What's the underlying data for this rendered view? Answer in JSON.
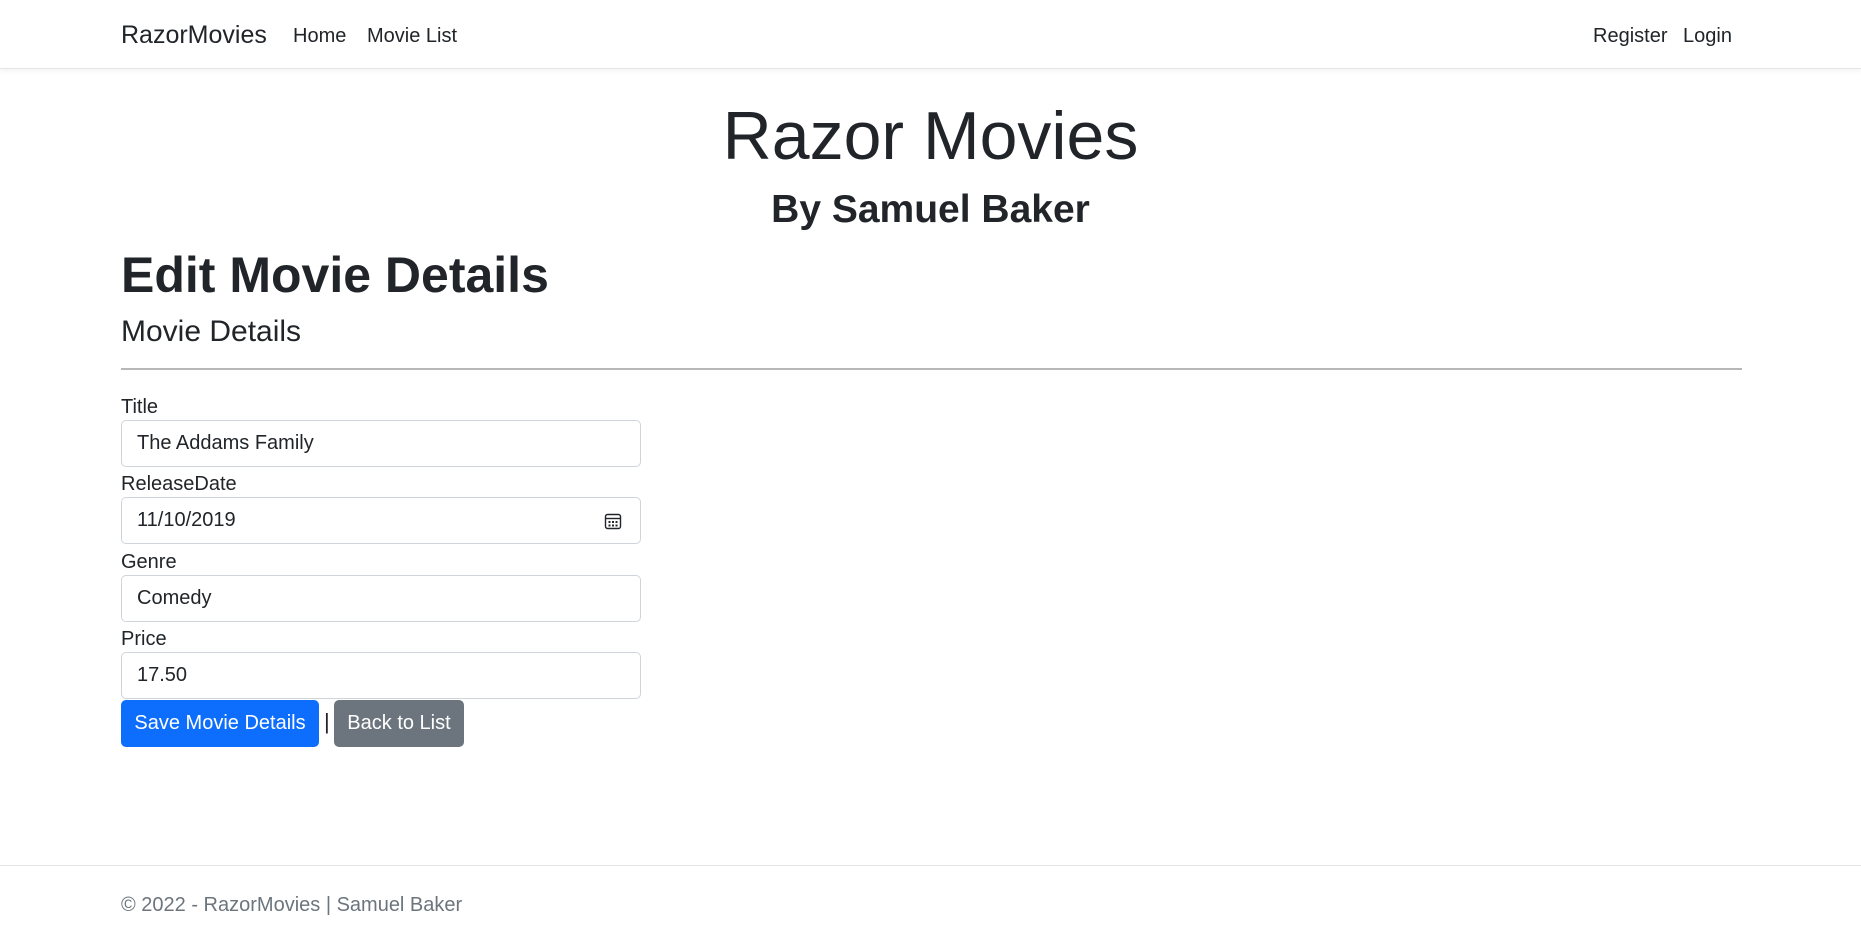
{
  "navbar": {
    "brand": "RazorMovies",
    "left_links": [
      "Home",
      "Movie List"
    ],
    "right_links": [
      "Register",
      "Login"
    ]
  },
  "hero": {
    "title": "Razor Movies",
    "subtitle": "By Samuel Baker"
  },
  "page": {
    "heading": "Edit Movie Details",
    "section_heading": "Movie Details"
  },
  "form": {
    "title_label": "Title",
    "title_value": "The Addams Family",
    "release_label": "ReleaseDate",
    "release_value": "11/10/2019",
    "release_icon": "calendar-icon",
    "genre_label": "Genre",
    "genre_value": "Comedy",
    "price_label": "Price",
    "price_value": "17.50",
    "save_label": "Save Movie Details",
    "separator": "|",
    "back_label": "Back to List"
  },
  "colors": {
    "primary": "#0d6efd",
    "secondary": "#6c757d",
    "text": "#212529",
    "footer_text": "#6c757d"
  },
  "footer": {
    "text": "© 2022 - RazorMovies | Samuel Baker"
  }
}
